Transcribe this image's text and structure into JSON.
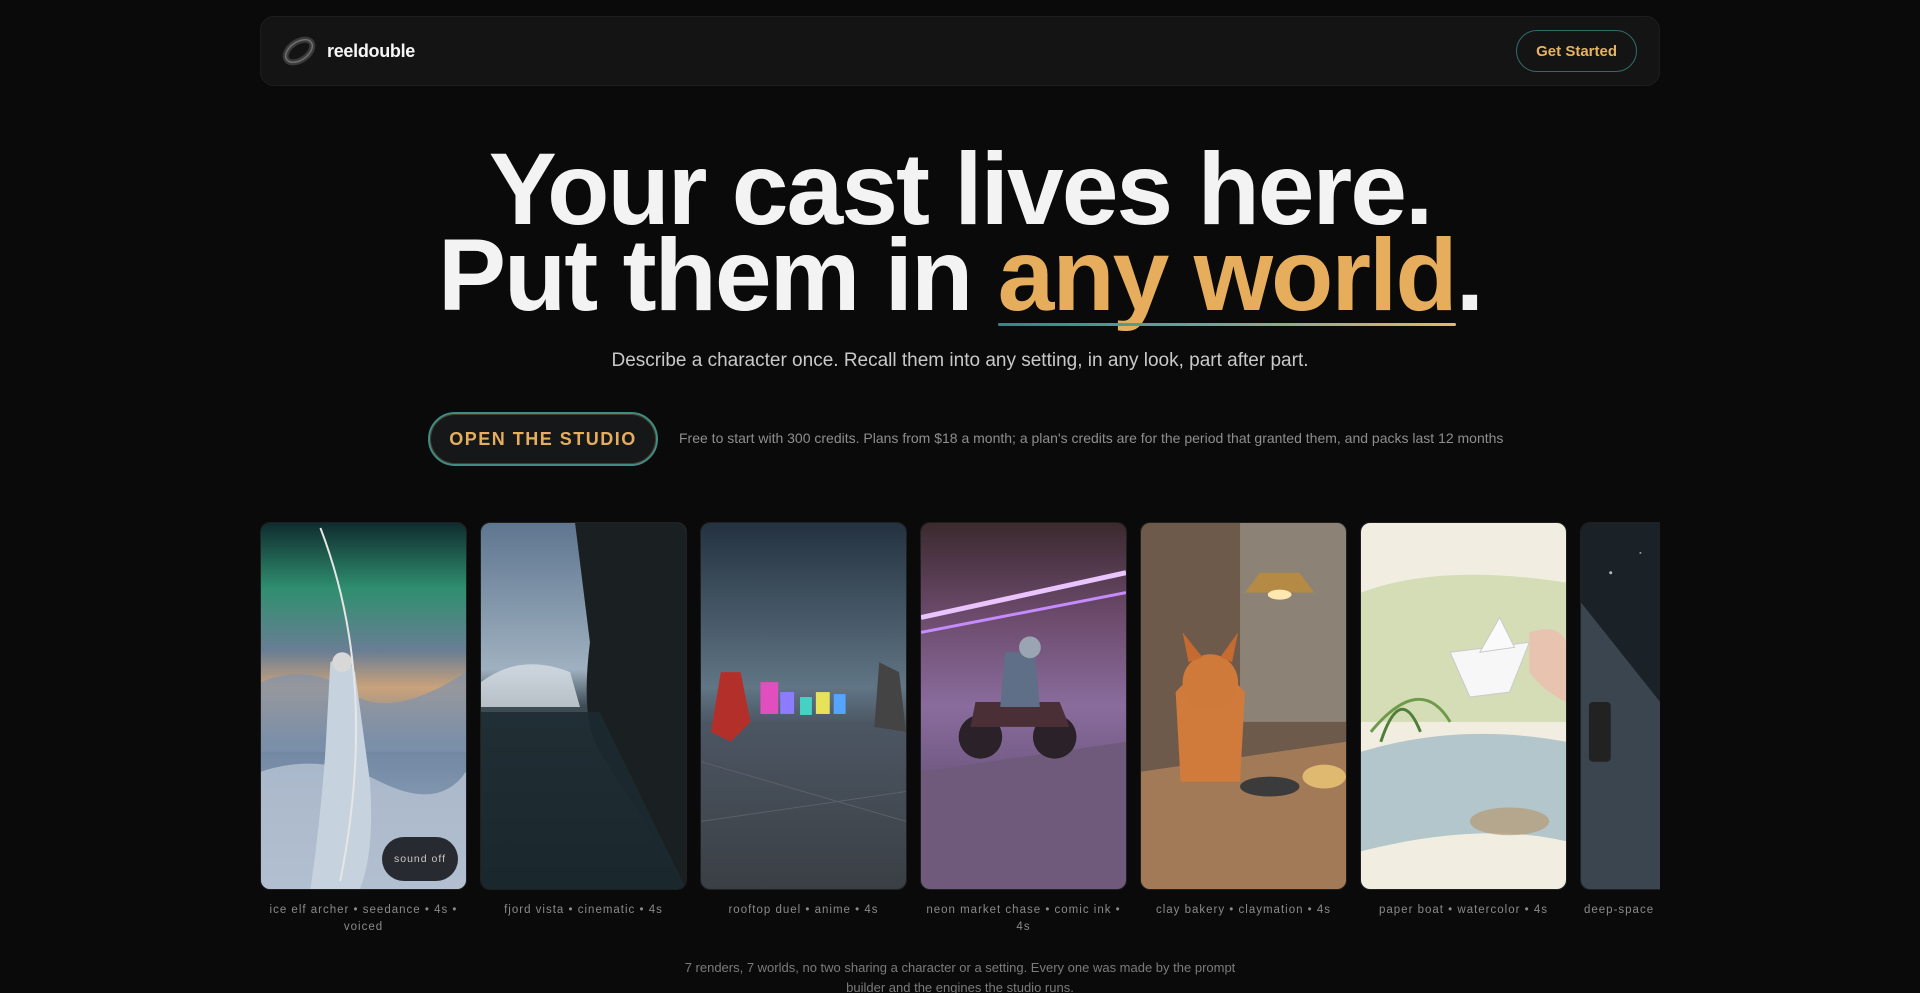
{
  "nav": {
    "brand": "reeldouble",
    "logo_icon": "ring-logo-icon",
    "cta_label": "Get Started"
  },
  "hero": {
    "line1": "Your cast lives here.",
    "line2_prefix": "Put them in ",
    "line2_accent": "any world",
    "line2_suffix": ".",
    "subtitle": "Describe a character once. Recall them into any setting, in any look, part after part."
  },
  "cta": {
    "label": "OPEN THE STUDIO",
    "note": "Free to start with 300 credits. Plans from $18 a month; a plan's credits are for the period that granted them, and packs last 12 months"
  },
  "cards": [
    {
      "caption": "ice elf archer • seedance • 4s • voiced",
      "sound": "sound off"
    },
    {
      "caption": "fjord vista • cinematic • 4s"
    },
    {
      "caption": "rooftop duel • anime • 4s"
    },
    {
      "caption": "neon market chase • comic ink • 4s"
    },
    {
      "caption": "clay bakery • claymation • 4s"
    },
    {
      "caption": "paper boat • watercolor • 4s"
    },
    {
      "caption": "deep-space"
    }
  ],
  "footnote": "7 renders, 7 worlds, no two sharing a character or a setting. Every one was made by the prompt builder and the engines the studio runs.",
  "colors": {
    "background": "#0a0a0a",
    "accent": "#e6ae5c",
    "teal": "#2f6e68"
  }
}
